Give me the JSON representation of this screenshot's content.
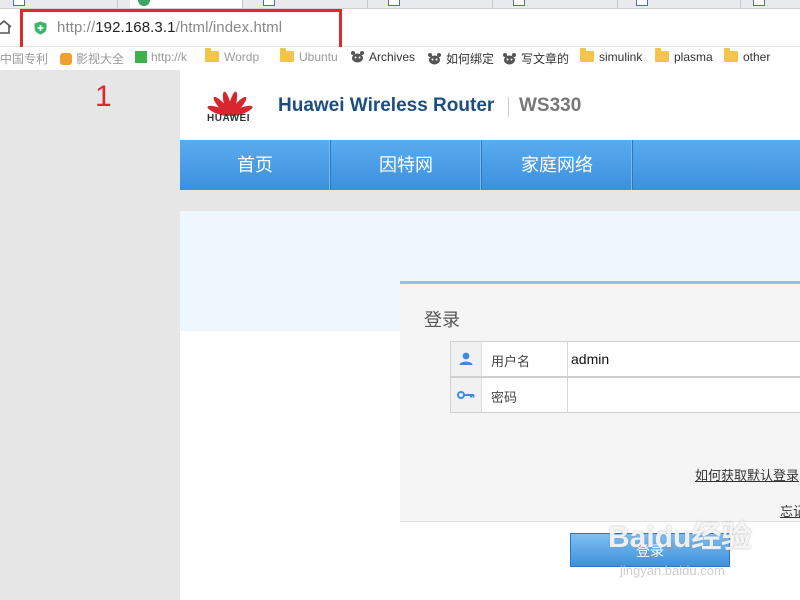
{
  "browser": {
    "tabs": [
      {
        "active": false
      },
      {
        "active": true
      },
      {
        "active": false
      },
      {
        "active": false
      },
      {
        "active": false
      },
      {
        "active": false
      },
      {
        "active": false
      }
    ],
    "url_scheme": "http://",
    "url_host": "192.168.3.1",
    "url_path": "/html/index.html",
    "bookmarks": [
      {
        "label": "中国专利",
        "icon": "none",
        "faded": true
      },
      {
        "label": "影视大全",
        "icon": "app-icon",
        "faded": true
      },
      {
        "label": "http://k",
        "icon": "green-square-icon",
        "faded": true
      },
      {
        "label": "Wordp",
        "icon": "folder-icon",
        "faded": true
      },
      {
        "label": "Ubuntu",
        "icon": "folder-icon",
        "faded": true
      },
      {
        "label": "Archives",
        "icon": "bear-icon",
        "faded": false
      },
      {
        "label": "如何绑定",
        "icon": "bear-icon",
        "faded": false
      },
      {
        "label": "写文章的",
        "icon": "bear-icon",
        "faded": false
      },
      {
        "label": "simulink",
        "icon": "folder-icon",
        "faded": false
      },
      {
        "label": "plasma",
        "icon": "folder-icon",
        "faded": false
      },
      {
        "label": "other",
        "icon": "folder-icon",
        "faded": false
      }
    ]
  },
  "annotation": {
    "step_number": "1",
    "color": "#e0282e"
  },
  "router": {
    "logo_text": "HUAWEI",
    "brand": "Huawei Wireless Router",
    "model": "WS330",
    "nav": [
      "首页",
      "因特网",
      "家庭网络"
    ],
    "login": {
      "title": "登录",
      "username_label": "用户名",
      "username_value": "admin",
      "password_label": "密码",
      "password_value": "",
      "default_login_link": "如何获取默认登录",
      "forgot_link": "忘记",
      "login_button": "登录"
    }
  },
  "watermark": {
    "main": "Baidu经验",
    "sub": "jingyan.baidu.com"
  },
  "colors": {
    "nav_blue": "#3c8fdd",
    "brand_text": "#1c4e80",
    "logo_red": "#d8262e",
    "highlight_red": "#e0282e"
  }
}
